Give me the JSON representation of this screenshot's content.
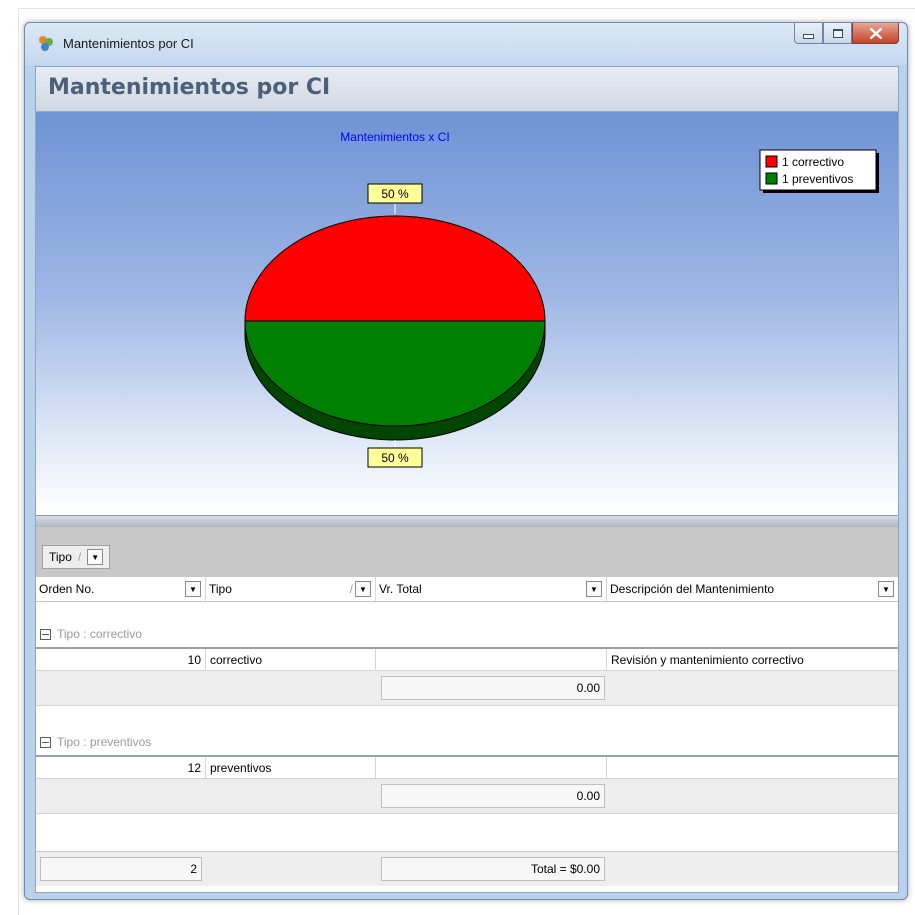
{
  "window": {
    "title": "Mantenimientos por CI"
  },
  "header": {
    "title": "Mantenimientos por CI"
  },
  "chart_data": {
    "type": "pie",
    "title": "Mantenimientos x CI",
    "slices": [
      {
        "label": "1 correctivo",
        "value": 50,
        "color": "#ff0000",
        "data_label": "50 %"
      },
      {
        "label": "1 preventivos",
        "value": 50,
        "color": "#008000",
        "data_label": "50 %"
      }
    ],
    "legend_position": "top-right",
    "title_color": "#0000ff"
  },
  "group_panel": {
    "label": "Tipo",
    "sort_glyph": "/"
  },
  "columns": [
    {
      "label": "Orden No."
    },
    {
      "label": "Tipo",
      "sort_glyph": "/"
    },
    {
      "label": "Vr. Total"
    },
    {
      "label": "Descripción del Mantenimiento"
    }
  ],
  "groups": [
    {
      "label": "Tipo : correctivo",
      "row": {
        "orden": "10",
        "tipo": "correctivo",
        "vr_total": "",
        "descripcion": "Revisión y mantenimiento correctivo"
      },
      "subtotal": "0.00"
    },
    {
      "label": "Tipo : preventivos",
      "row": {
        "orden": "12",
        "tipo": "preventivos",
        "vr_total": "",
        "descripcion": ""
      },
      "subtotal": "0.00"
    }
  ],
  "footer": {
    "count": "2",
    "total": "Total = $0.00"
  },
  "icons": {
    "app": "app-icon",
    "minimize": "minimize-icon",
    "maximize": "maximize-icon",
    "close": "close-icon",
    "dropdown": "dropdown-arrow-icon",
    "collapse": "collapse-icon"
  }
}
